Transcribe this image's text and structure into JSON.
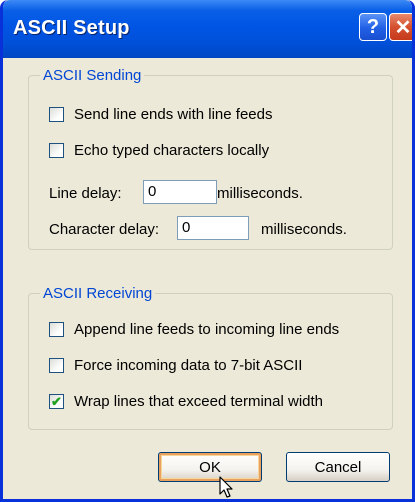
{
  "window": {
    "title": "ASCII Setup",
    "title_buttons": {
      "help_label": "?",
      "close_label": "✕"
    },
    "colors": {
      "titlebar": "#0055e5",
      "group_label": "#0046d5",
      "checkmark": "#21a121"
    }
  },
  "sending": {
    "title": "ASCII Sending",
    "options": [
      {
        "label": "Send line ends with line feeds",
        "checked": false
      },
      {
        "label": "Echo typed characters locally",
        "checked": false
      }
    ],
    "line_delay": {
      "label": "Line delay:",
      "value": "0",
      "unit": "milliseconds."
    },
    "character_delay": {
      "label": "Character delay:",
      "value": "0",
      "unit": "milliseconds."
    }
  },
  "receiving": {
    "title": "ASCII Receiving",
    "options": [
      {
        "label": "Append line feeds to incoming line ends",
        "checked": false
      },
      {
        "label": "Force incoming data to 7-bit ASCII",
        "checked": false
      },
      {
        "label": "Wrap lines that exceed terminal width",
        "checked": true
      }
    ]
  },
  "buttons": {
    "ok": "OK",
    "cancel": "Cancel"
  }
}
